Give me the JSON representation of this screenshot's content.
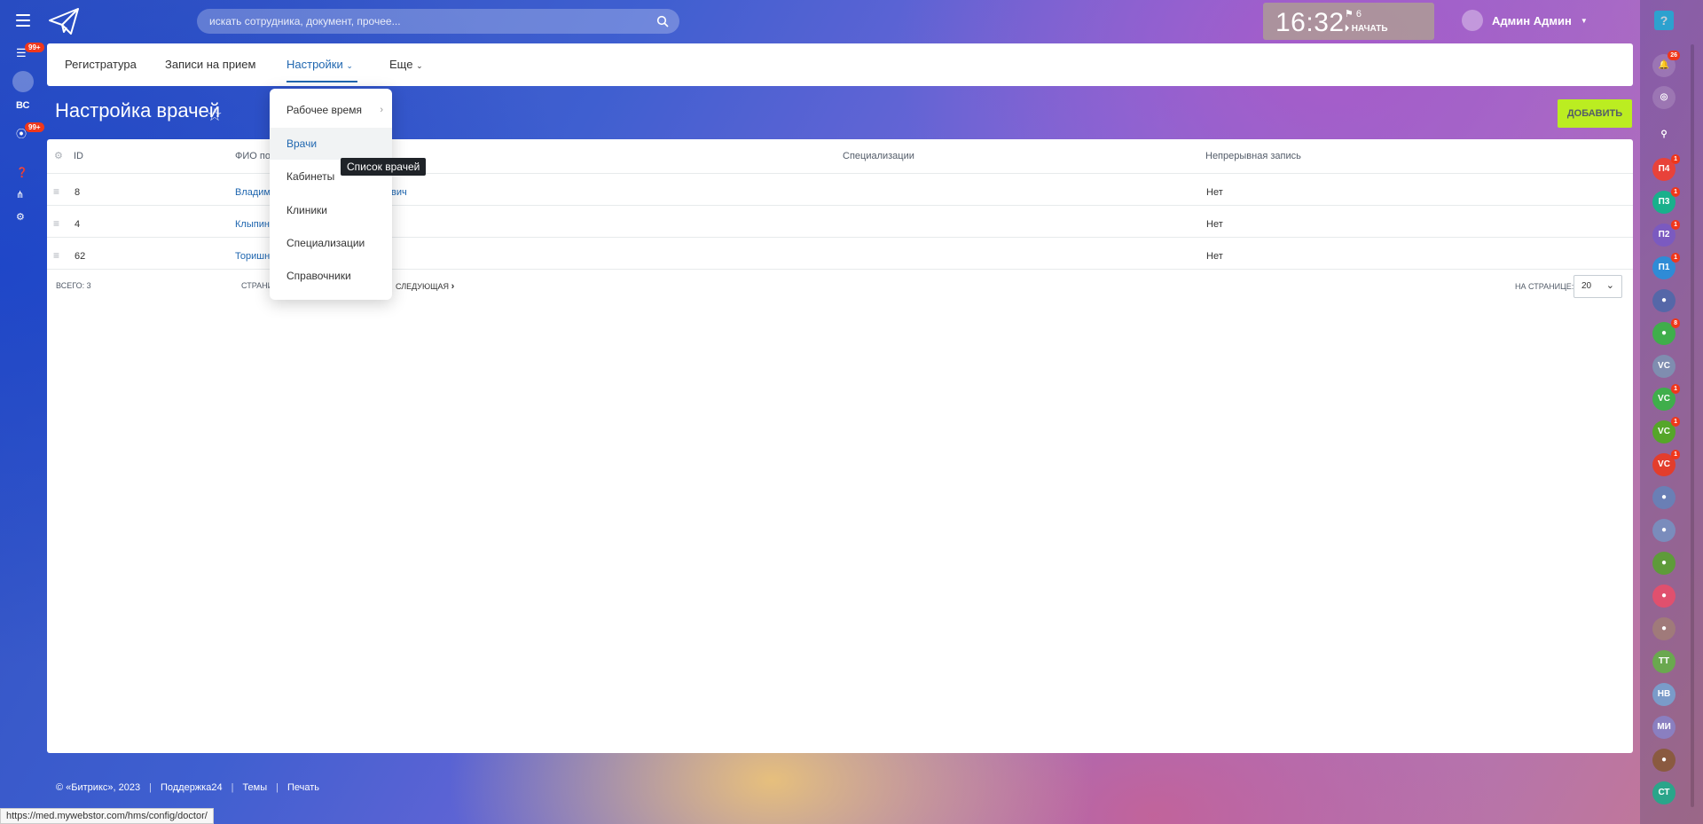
{
  "header": {
    "search_placeholder": "искать сотрудника, документ, прочее...",
    "clock": "16:32",
    "flag_count": "6",
    "start_label": "НАЧАТЬ",
    "user_name": "Админ Админ",
    "help_label": "?"
  },
  "left_sidebar": {
    "filter_badge": "99+",
    "initials": "ВС",
    "tasks_badge": "99+"
  },
  "menu": {
    "items": [
      "Регистратура",
      "Записи на прием",
      "Настройки",
      "Еще"
    ],
    "active": "Настройки"
  },
  "page": {
    "title": "Настройка врачей",
    "add_button": "ДОБАВИТЬ"
  },
  "table": {
    "columns": [
      "ID",
      "ФИО по",
      "Специализации",
      "Непрерывная запись"
    ],
    "rows": [
      {
        "id": "8",
        "name_start": "Владим",
        "name_end": "вич",
        "continuous": "Нет"
      },
      {
        "id": "4",
        "name_start": "Клыпин",
        "name_end": "",
        "continuous": "Нет"
      },
      {
        "id": "62",
        "name_start": "Торишн",
        "name_end": "",
        "continuous": "Нет"
      }
    ],
    "total": "ВСЕГО: 3",
    "pages_label": "СТРАНИ",
    "next_label": "СЛЕДУЮЩАЯ",
    "per_page_label": "НА СТРАНИЦЕ:",
    "per_page_value": "20"
  },
  "dropdown": {
    "items": [
      "Рабочее время",
      "Врачи",
      "Кабинеты",
      "Клиники",
      "Специализации",
      "Справочники"
    ],
    "hovered": "Врачи",
    "tooltip": "Список врачей"
  },
  "footer": {
    "copyright": "© «Битрикс», 2023",
    "support": "Поддержка24",
    "themes": "Темы",
    "print": "Печать"
  },
  "status_url": "https://med.mywebstor.com/hms/config/doctor/",
  "right_sidebar": {
    "notif_badge": "26",
    "items": [
      {
        "label": "П4",
        "color": "#e8423a",
        "badge": "1"
      },
      {
        "label": "П3",
        "color": "#19b08c",
        "badge": "1"
      },
      {
        "label": "П2",
        "color": "#7b5ac0",
        "badge": "1"
      },
      {
        "label": "П1",
        "color": "#2f8bd6",
        "badge": "1"
      },
      {
        "label": "",
        "color": "#5567a8",
        "badge": ""
      },
      {
        "label": "",
        "color": "#3fae4b",
        "badge": "8"
      },
      {
        "label": "VC",
        "color": "#7f8db0",
        "badge": ""
      },
      {
        "label": "VC",
        "color": "#3fae4b",
        "badge": "1"
      },
      {
        "label": "VC",
        "color": "#55a629",
        "badge": "1"
      },
      {
        "label": "VC",
        "color": "#e33d2c",
        "badge": "1"
      },
      {
        "label": "",
        "color": "#6a7fb5",
        "badge": ""
      },
      {
        "label": "",
        "color": "#7a8cbc",
        "badge": ""
      },
      {
        "label": "",
        "color": "#5e9b3a",
        "badge": ""
      },
      {
        "label": "",
        "color": "#e0506e",
        "badge": ""
      },
      {
        "label": "",
        "color": "#a07a7a",
        "badge": ""
      },
      {
        "label": "ТТ",
        "color": "#6aa84f",
        "badge": ""
      },
      {
        "label": "НВ",
        "color": "#7a9bc9",
        "badge": ""
      },
      {
        "label": "МИ",
        "color": "#8a7fc0",
        "badge": ""
      },
      {
        "label": "",
        "color": "#8a5a40",
        "badge": ""
      },
      {
        "label": "СТ",
        "color": "#2aa58a",
        "badge": ""
      }
    ]
  },
  "colors": {
    "accent": "#2067b0",
    "add_button": "#bbed21",
    "badge": "#f0371b",
    "help": "#2fc6f6"
  }
}
